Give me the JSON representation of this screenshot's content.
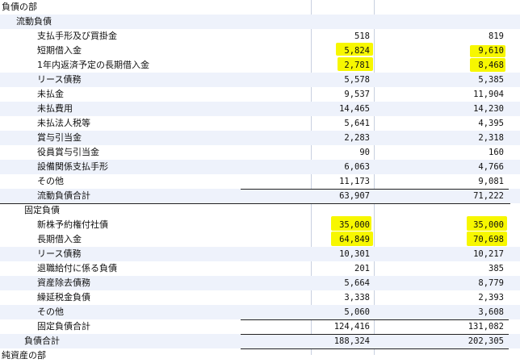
{
  "sections": {
    "section_title": "負債の部",
    "current_title": "流動負債",
    "fixed_title": "固定負債",
    "next_section": "純資産の部"
  },
  "rows": [
    {
      "label": "支払手形及び買掛金",
      "prev": "518",
      "curr": "819"
    },
    {
      "label": "短期借入金",
      "prev": "5,824",
      "curr": "9,610"
    },
    {
      "label": "1年内返済予定の長期借入金",
      "prev": "2,781",
      "curr": "8,468"
    },
    {
      "label": "リース債務",
      "prev": "5,578",
      "curr": "5,385"
    },
    {
      "label": "未払金",
      "prev": "9,537",
      "curr": "11,904"
    },
    {
      "label": "未払費用",
      "prev": "14,465",
      "curr": "14,230"
    },
    {
      "label": "未払法人税等",
      "prev": "5,641",
      "curr": "4,395"
    },
    {
      "label": "賞与引当金",
      "prev": "2,283",
      "curr": "2,318"
    },
    {
      "label": "役員賞与引当金",
      "prev": "90",
      "curr": "160"
    },
    {
      "label": "設備関係支払手形",
      "prev": "6,063",
      "curr": "4,766"
    },
    {
      "label": "その他",
      "prev": "11,173",
      "curr": "9,081"
    },
    {
      "label": "流動負債合計",
      "prev": "63,907",
      "curr": "71,222"
    },
    {
      "label": "新株予約権付社債",
      "prev": "35,000",
      "curr": "35,000"
    },
    {
      "label": "長期借入金",
      "prev": "64,849",
      "curr": "70,698"
    },
    {
      "label": "リース債務",
      "prev": "10,301",
      "curr": "10,217"
    },
    {
      "label": "退職給付に係る負債",
      "prev": "201",
      "curr": "385"
    },
    {
      "label": "資産除去債務",
      "prev": "5,664",
      "curr": "8,779"
    },
    {
      "label": "繰延税金負債",
      "prev": "3,338",
      "curr": "2,393"
    },
    {
      "label": "その他",
      "prev": "5,060",
      "curr": "3,608"
    },
    {
      "label": "固定負債合計",
      "prev": "124,416",
      "curr": "131,082"
    },
    {
      "label": "負債合計",
      "prev": "188,324",
      "curr": "202,305"
    }
  ],
  "highlight_color": "#f7f700"
}
